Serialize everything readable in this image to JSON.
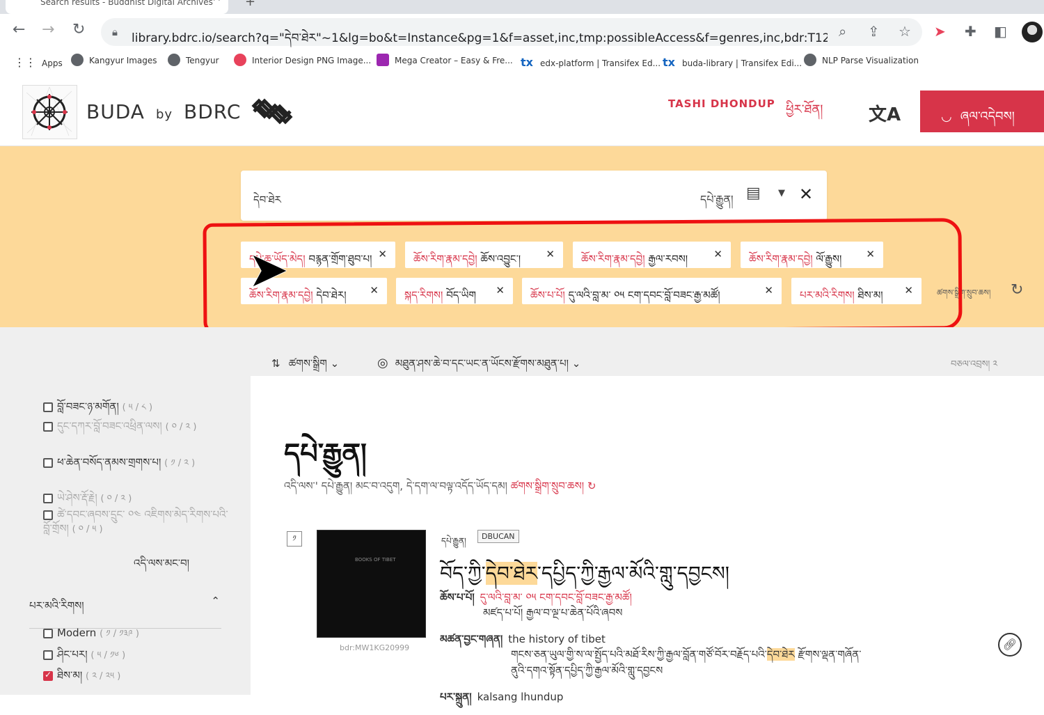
{
  "browser": {
    "tab_title": "Search results - Buddhist Digital Archives",
    "url": "library.bdrc.io/search?q=\"དེབ་ཐེར\"~1&lg=bo&t=Instance&pg=1&f=asset,inc,tmp:possibleAccess&f=genres,inc,bdr:T12&f...",
    "bookmarks": [
      {
        "label": "Apps",
        "color": "#5f6368"
      },
      {
        "label": "Kangyur Images",
        "color": "#5f6368"
      },
      {
        "label": "Tengyur",
        "color": "#5f6368"
      },
      {
        "label": "Interior Design PNG Image...",
        "color": "#e8425b"
      },
      {
        "label": "Mega Creator – Easy & Fre...",
        "color": "#9c27b0"
      },
      {
        "label": "edx-platform | Transifex Ed...",
        "color": "#1565c0"
      },
      {
        "label": "buda-library | Transifex Edi...",
        "color": "#1565c0"
      },
      {
        "label": "NLP Parse Visualization",
        "color": "#5f6368"
      }
    ]
  },
  "header": {
    "brand": "BUDA",
    "by": "by",
    "org": "BDRC",
    "username": "TASHI DHONDUP",
    "logout": "ཕྱིར་ཐོན།",
    "donate": "ཞལ་འདེབས།",
    "accent": "#d73449"
  },
  "search": {
    "query": "དེབ་ཐེར",
    "datatype": "དཔེ་རྒྱུན།",
    "band_color": "#fdd999"
  },
  "filters": [
    {
      "key": "དཔེ་ཆ་ཡོད་མེད།",
      "value": "བརྙན་གྲོག་ཐུབ་པ།"
    },
    {
      "key": "ཆོས་རིག་རྣམ་དབྱེ།",
      "value": "ཆོས་འབྱུང་།"
    },
    {
      "key": "ཆོས་རིག་རྣམ་དབྱེ།",
      "value": "རྒྱལ་རབས།"
    },
    {
      "key": "ཆོས་རིག་རྣམ་དབྱེ།",
      "value": "ལོ་རྒྱུས།"
    },
    {
      "key": "ཆོས་རིག་རྣམ་དབྱེ།",
      "value": "དེབ་ཐེར།"
    },
    {
      "key": "སྐད་རིགས།",
      "value": "བོད་ཡིག"
    },
    {
      "key": "ཆོས་པ་པོ།",
      "value": "དུ་ལའི་བླ་མ་ ༠༥ ངག་དབང་བློ་བཟང་རྒྱ་མཚོ།"
    },
    {
      "key": "པར་མའི་རིགས།",
      "value": "ཐིས་མ།"
    }
  ],
  "reset_filters": "ཚགས་སྒྲིག་སྲུབ་ཆས།",
  "toolbar": {
    "sort": "ཚགས་སྒྲིག",
    "match": "མཐུན་ཤས་ཆེ་བ་དང་ཡང་ན་ཡོངས་རྫོགས་མཐུན་པ།",
    "count": "བཅལ་འབྲས། ༢"
  },
  "sidebar": {
    "items": [
      {
        "label": "བློ་བཟང་ཉ་མགོན།",
        "count": "( ༥ / ༨ )",
        "checked": false,
        "dim": false
      },
      {
        "label": "དུང་དཀར་བློ་བཟང་འཕྲིན་ལས།",
        "count": "( ༠ / ༢ )",
        "checked": false,
        "dim": true
      },
      {
        "label": "ཕ་ཆེན་བསོད་ནམས་གྲགས་པ།",
        "count": "( ༡ / ༢ )",
        "checked": false,
        "dim": false
      },
      {
        "label": "ཡེ་ཤེས་རྡོ་རྗེ།",
        "count": "( ༠ / ༢ )",
        "checked": false,
        "dim": true
      },
      {
        "label": "ཚེ་དབང་ཞབས་དྲུང་ ༠༤ འཇིགས་མེད་རིགས་པའི་བློ་གྲོས།",
        "count": "( ༠ / ༥ )",
        "checked": false,
        "dim": true
      }
    ],
    "see_less": "འདི་ལས་མང་བ།",
    "section_title": "པར་མའི་རིགས།",
    "section_items": [
      {
        "label": "Modern",
        "count": "( ༡ / ༡༣༩ )",
        "checked": false
      },
      {
        "label": "ཤིང་པར།",
        "count": "( ༥ / ༡༦ )",
        "checked": false
      },
      {
        "label": "ཐིས་མ།",
        "count": "( ༢ / ༢༥ )",
        "checked": true
      }
    ]
  },
  "results": {
    "heading": "དཔེ་རྒྱུན།",
    "description": "འདི་ལས་' དཔེ་རྒྱུན། མང་བ་འདུག, དེ་དག་ལ་བལྟ་འདོད་ཡོད་དམ།",
    "description_link": "ཚགས་སྒྲིག་སྲུབ་ཆས།",
    "items": [
      {
        "index": "༡",
        "type": "དཔེ་རྒྱུན།",
        "badge": "DBUCAN",
        "title_pre": "བོད་ཀྱི་",
        "title_hl": "དེབ་ཐེར",
        "title_post": "་དཔྱིད་ཀྱི་རྒྱལ་མོའི་གླུ་དབྱངས།",
        "author_label": "ཆོས་པ་པོ།",
        "author": "དུ་ལའི་བླ་མ་ ༠༥ ངག་དབང་བློ་བཟང་རྒྱ་མཚོ།",
        "author_note": "མཛད་པ་པོ། རྒྱལ་བ་ལྔ་པ་ཆེན་པོའི་ཞབས",
        "alt_title_label": "མཚན་བྱང་གཞན།",
        "alt_title": "the history of tibet",
        "alt_line2_pre": "གངས་ཅན་ཡུལ་གྱི་ས་ལ་སྤྱོད་པའི་མཐོ་རིས་ཀྱི་རྒྱལ་བློན་གཙོ་བོར་བརྗོད་པའི་",
        "alt_line2_hl": "དེབ་ཐེར",
        "alt_line2_post": "རྫོགས་ལྡན་གཞོན་",
        "alt_line3": "ནུའི་དགའ་སྟོན་དཔྱིད་ཀྱི་རྒྱལ་མོའི་གླུ་དབྱངས",
        "publisher_label": "པར་སྐྲུན།",
        "publisher": "kalsang lhundup",
        "id": "bdr:MW1KG20999",
        "thumb_text": "BOOKS OF TIBET"
      }
    ]
  }
}
